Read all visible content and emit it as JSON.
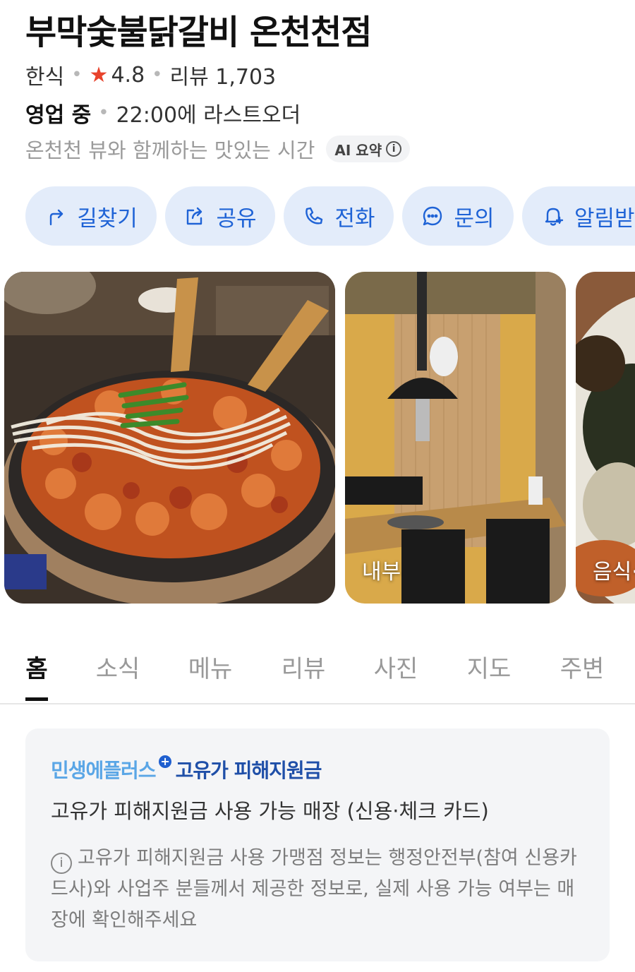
{
  "place": {
    "name": "부막숯불닭갈비 온천천점",
    "category": "한식",
    "rating": "4.8",
    "reviews": "리뷰 1,703",
    "status": "영업 중",
    "last_order": "22:00에 라스트오더",
    "summary": "온천천 뷰와 함께하는 맛있는 시간",
    "ai_label": "AI 요약"
  },
  "actions": [
    {
      "label": "길찾기",
      "icon": "directions-arrow-icon"
    },
    {
      "label": "공유",
      "icon": "share-icon"
    },
    {
      "label": "전화",
      "icon": "phone-icon"
    },
    {
      "label": "문의",
      "icon": "chat-bubble-icon"
    },
    {
      "label": "알림받기",
      "icon": "bell-plus-icon"
    }
  ],
  "photos": [
    {
      "label": ""
    },
    {
      "label": "내부"
    },
    {
      "label": "음식·음료"
    }
  ],
  "tabs": [
    "홈",
    "소식",
    "메뉴",
    "리뷰",
    "사진",
    "지도",
    "주변"
  ],
  "active_tab": "홈",
  "notice": {
    "brand_part1": "민생에플러스",
    "brand_part2": "고유가 피해지원금",
    "headline": "고유가 피해지원금 사용 가능 매장 (신용·체크 카드)",
    "disclaimer": "고유가 피해지원금 사용 가맹점 정보는 행정안전부(참여 신용카드사)와 사업주 분들께서 제공한 정보로, 실제 사용 가능 여부는 매장에 확인해주세요"
  },
  "colors": {
    "accent": "#1f63d6",
    "button_bg": "#e3ecfa",
    "star": "#e8432c"
  }
}
